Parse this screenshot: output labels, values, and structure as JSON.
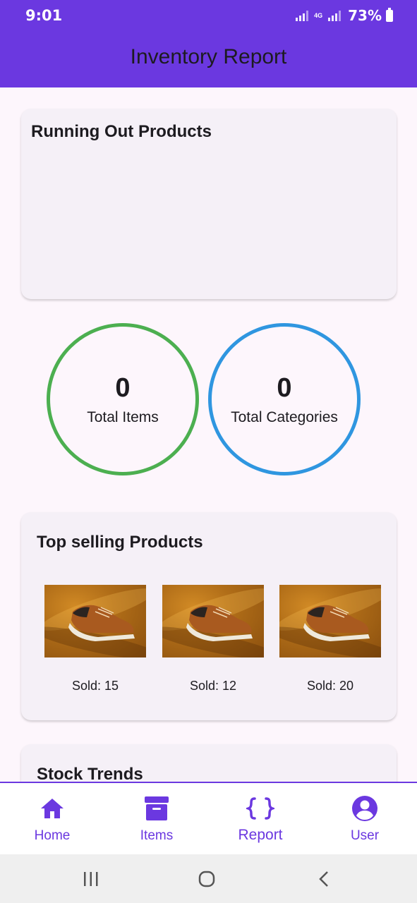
{
  "status_bar": {
    "time": "9:01",
    "network": "4G",
    "battery": "73%"
  },
  "app_bar": {
    "title": "Inventory Report"
  },
  "running_out": {
    "title": "Running Out Products"
  },
  "stats": [
    {
      "value": "0",
      "label": "Total Items",
      "color": "#4caf50"
    },
    {
      "value": "0",
      "label": "Total Categories",
      "color": "#2f96e0"
    }
  ],
  "top_selling": {
    "title": "Top selling Products",
    "products": [
      {
        "sold": "Sold: 15",
        "image": "sneaker-photo"
      },
      {
        "sold": "Sold: 12",
        "image": "sneaker-photo"
      },
      {
        "sold": "Sold: 20",
        "image": "sneaker-photo"
      }
    ]
  },
  "stock_trends": {
    "title": "Stock Trends"
  },
  "bottom_nav": {
    "items": [
      {
        "label": "Home",
        "icon": "home-icon"
      },
      {
        "label": "Items",
        "icon": "archive-icon"
      },
      {
        "label": "Report",
        "icon": "braces-icon",
        "active": true
      },
      {
        "label": "User",
        "icon": "account-circle-icon"
      }
    ]
  },
  "system_nav": {
    "icons": [
      "recents-icon",
      "home-circle-icon",
      "back-icon"
    ]
  },
  "colors": {
    "primary": "#6b38e0",
    "background": "#fdf6fc",
    "card": "#f5f0f7"
  }
}
